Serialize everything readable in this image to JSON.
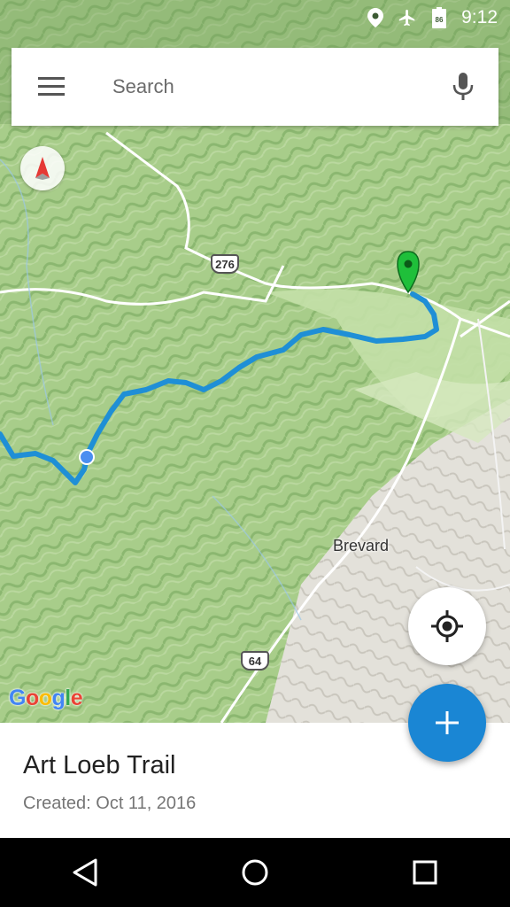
{
  "status_bar": {
    "time": "9:12",
    "battery_level": "86",
    "icons": [
      "location-icon",
      "airplane-mode-icon",
      "battery-icon"
    ]
  },
  "search": {
    "placeholder": "Search"
  },
  "map": {
    "road_labels": [
      "276",
      "64"
    ],
    "city_label": "Brevard",
    "attribution": "Google",
    "colors": {
      "terrain": "#a9cf8c",
      "terrain_dark": "#86b46c",
      "urban": "#e4e2dc",
      "trail": "#1f8fd6",
      "roads": "#ffffff",
      "marker": "#1fbf3a"
    }
  },
  "trail": {
    "name": "Art Loeb Trail",
    "created": "Created: Oct 11, 2016"
  },
  "accent_color": "#1a86d4"
}
